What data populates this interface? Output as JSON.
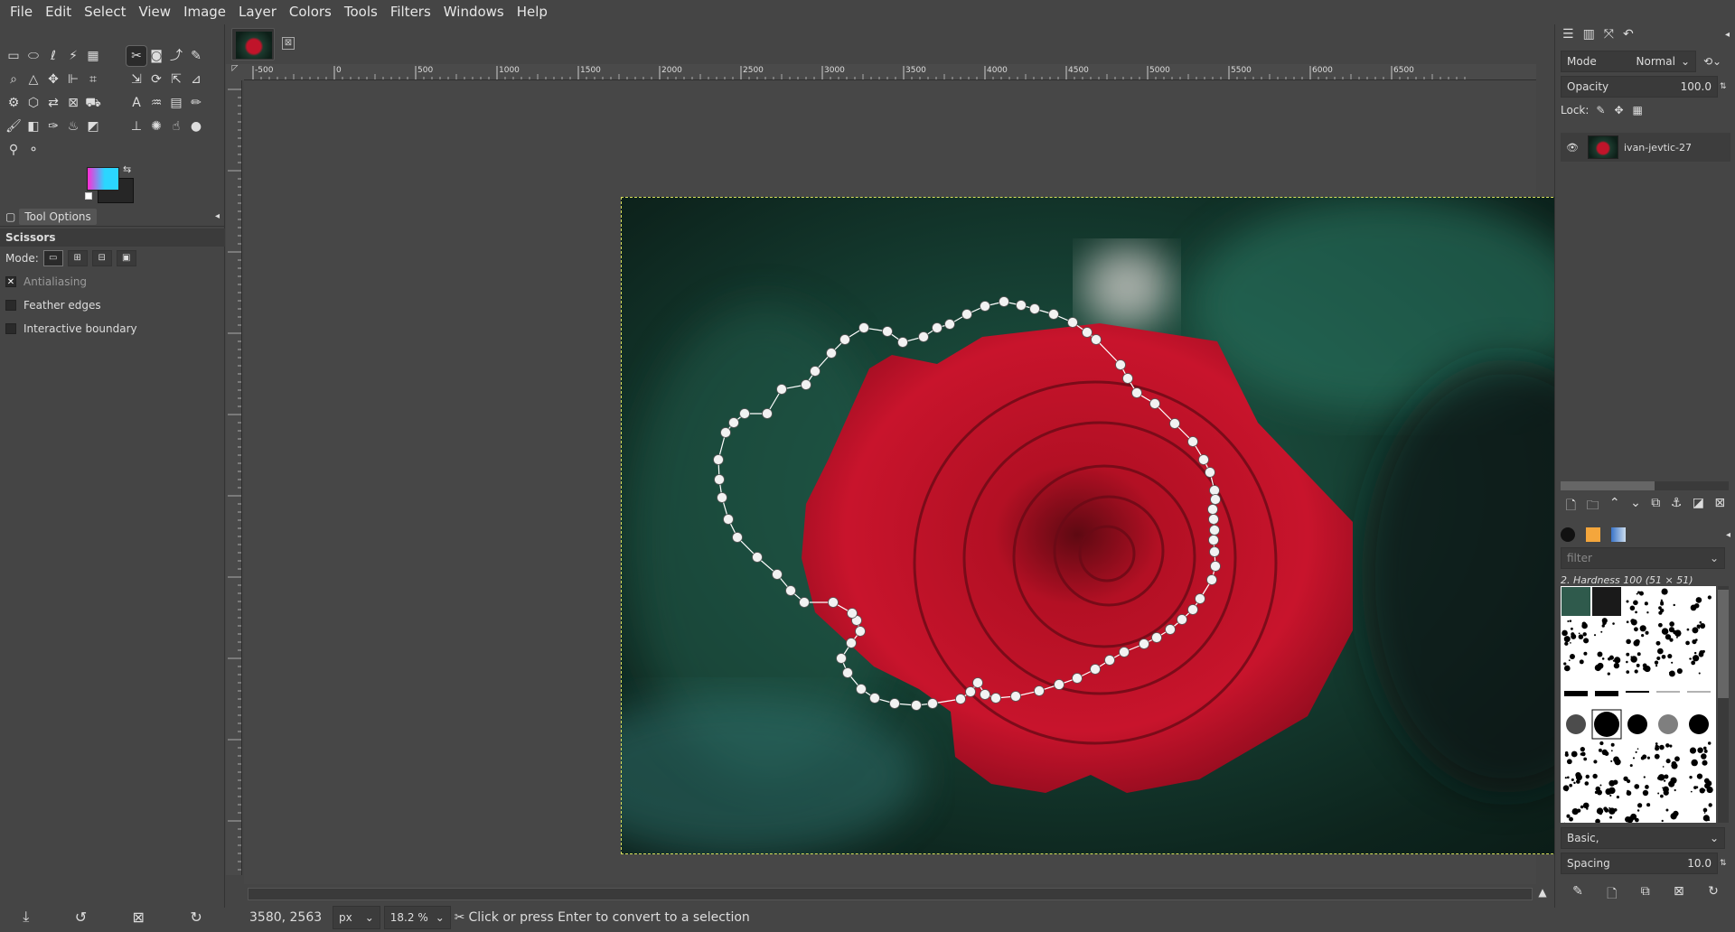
{
  "menubar": [
    "File",
    "Edit",
    "Select",
    "View",
    "Image",
    "Layer",
    "Colors",
    "Tools",
    "Filters",
    "Windows",
    "Help"
  ],
  "toolbox": {
    "tab_label": "Tool Options",
    "tool_title": "Scissors",
    "mode_label": "Mode:",
    "options": [
      {
        "label": "Antialiasing",
        "checked": true,
        "disabled": true
      },
      {
        "label": "Feather edges",
        "checked": false
      },
      {
        "label": "Interactive boundary",
        "checked": false
      }
    ]
  },
  "image_tab": {
    "close": "⊠"
  },
  "rulers": {
    "h_ticks": [
      "-500",
      "|0",
      "|500",
      "|1000",
      "|1500",
      "|2000",
      "|2500",
      "|3000",
      "|3500",
      "|4000",
      "|4500",
      "|5000",
      "|5500",
      "|6000",
      "|6500"
    ]
  },
  "status": {
    "coords": "3580, 2563",
    "unit": "px",
    "zoom": "18.2 %",
    "message": "Click or press Enter to convert to a selection"
  },
  "layers": {
    "mode_label": "Mode",
    "mode_value": "Normal",
    "opacity_label": "Opacity",
    "opacity_value": "100.0",
    "lock_label": "Lock:",
    "layer_name": "ivan-jevtic-27"
  },
  "brushes": {
    "filter_placeholder": "filter",
    "selected": "2. Hardness 100 (51 × 51)",
    "preset": "Basic,",
    "spacing_label": "Spacing",
    "spacing_value": "10.0"
  },
  "colors": {
    "selection_dash": "#d9e05a",
    "rose": "#c0142a"
  }
}
